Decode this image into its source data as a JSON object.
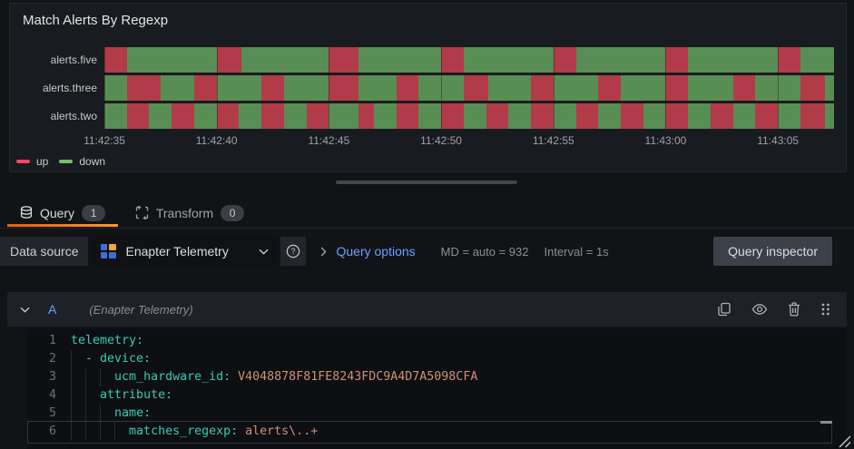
{
  "colors": {
    "accent_orange_start": "#e55e11",
    "accent_orange_end": "#ff9830",
    "link_blue": "#6e9fff",
    "legend_up": "#f2495c",
    "legend_down": "#73bf69",
    "fill_up": "#b23b4a",
    "fill_down": "#588e53"
  },
  "panel": {
    "title": "Match Alerts By Regexp"
  },
  "chart_data": {
    "type": "state-timeline",
    "title": "Match Alerts By Regexp",
    "x_range_seconds": [
      0,
      32.5
    ],
    "tick_interval_s": 5,
    "x_ticks": [
      "11:42:35",
      "11:42:40",
      "11:42:45",
      "11:42:50",
      "11:42:55",
      "11:43:00",
      "11:43:05"
    ],
    "legend": [
      {
        "label": "up",
        "state": "up"
      },
      {
        "label": "down",
        "state": "down"
      }
    ],
    "rows": [
      {
        "label": "alerts.five",
        "segments": [
          [
            "up",
            0,
            1
          ],
          [
            "down",
            1,
            5
          ],
          [
            "up",
            5,
            6.1
          ],
          [
            "down",
            6.1,
            10
          ],
          [
            "up",
            10,
            11.3
          ],
          [
            "down",
            11.3,
            15
          ],
          [
            "up",
            15,
            16
          ],
          [
            "down",
            16,
            20
          ],
          [
            "up",
            20,
            21
          ],
          [
            "down",
            21,
            25
          ],
          [
            "up",
            25,
            26
          ],
          [
            "down",
            26,
            30
          ],
          [
            "up",
            30,
            31
          ],
          [
            "down",
            31,
            32.5
          ]
        ]
      },
      {
        "label": "alerts.three",
        "segments": [
          [
            "down",
            0,
            1
          ],
          [
            "up",
            1,
            2.5
          ],
          [
            "down",
            2.5,
            4
          ],
          [
            "up",
            4,
            5
          ],
          [
            "down",
            5,
            7
          ],
          [
            "up",
            7,
            8
          ],
          [
            "down",
            8,
            10
          ],
          [
            "up",
            10,
            11.3
          ],
          [
            "down",
            11.3,
            13
          ],
          [
            "up",
            13,
            14
          ],
          [
            "down",
            14,
            16
          ],
          [
            "up",
            16,
            17.1
          ],
          [
            "down",
            17.1,
            19
          ],
          [
            "up",
            19,
            20
          ],
          [
            "down",
            20,
            22
          ],
          [
            "up",
            22,
            23
          ],
          [
            "down",
            23,
            25
          ],
          [
            "up",
            25,
            26
          ],
          [
            "down",
            26,
            28
          ],
          [
            "up",
            28,
            29
          ],
          [
            "down",
            29,
            31
          ],
          [
            "up",
            31,
            32.1
          ],
          [
            "down",
            32.1,
            32.5
          ]
        ]
      },
      {
        "label": "alerts.two",
        "segments": [
          [
            "down",
            0,
            1
          ],
          [
            "up",
            1,
            2
          ],
          [
            "down",
            2,
            3
          ],
          [
            "up",
            3,
            4
          ],
          [
            "down",
            4,
            5
          ],
          [
            "up",
            5,
            6
          ],
          [
            "down",
            6,
            7
          ],
          [
            "up",
            7,
            8
          ],
          [
            "down",
            8,
            9
          ],
          [
            "up",
            9,
            10
          ],
          [
            "down",
            10,
            11.3
          ],
          [
            "up",
            11.3,
            12
          ],
          [
            "down",
            12,
            13
          ],
          [
            "up",
            13,
            14
          ],
          [
            "down",
            14,
            15
          ],
          [
            "up",
            15,
            16
          ],
          [
            "down",
            16,
            17
          ],
          [
            "up",
            17,
            18
          ],
          [
            "down",
            18,
            19
          ],
          [
            "up",
            19,
            20
          ],
          [
            "down",
            20,
            21
          ],
          [
            "up",
            21,
            22
          ],
          [
            "down",
            22,
            23
          ],
          [
            "up",
            23,
            24
          ],
          [
            "down",
            24,
            25
          ],
          [
            "up",
            25,
            26
          ],
          [
            "down",
            26,
            27
          ],
          [
            "up",
            27,
            28
          ],
          [
            "down",
            28,
            29
          ],
          [
            "up",
            29,
            30
          ],
          [
            "down",
            30,
            31
          ],
          [
            "up",
            31,
            32.1
          ],
          [
            "down",
            32.1,
            32.5
          ]
        ]
      }
    ]
  },
  "tabs": {
    "query": {
      "label": "Query",
      "badge": "1"
    },
    "transform": {
      "label": "Transform",
      "badge": "0"
    }
  },
  "toolbar": {
    "datasource_label": "Data source",
    "datasource_value": "Enapter Telemetry",
    "query_options_label": "Query options",
    "stat_md": "MD = auto = 932",
    "stat_interval": "Interval = 1s",
    "query_inspector_label": "Query inspector"
  },
  "query_row": {
    "ref_id": "A",
    "datasource_hint": "(Enapter Telemetry)"
  },
  "editor": {
    "lines": [
      {
        "num": "1",
        "guides": 0,
        "tokens": [
          [
            "key",
            "telemetry:"
          ]
        ]
      },
      {
        "num": "2",
        "guides": 1,
        "tokens": [
          [
            "plain",
            "  "
          ],
          [
            "key",
            "- device:"
          ]
        ]
      },
      {
        "num": "3",
        "guides": 3,
        "tokens": [
          [
            "plain",
            "      "
          ],
          [
            "key",
            "ucm_hardware_id:"
          ],
          [
            "value",
            " V4048878F81FE8243FDC9A4D7A5098CFA"
          ]
        ]
      },
      {
        "num": "4",
        "guides": 2,
        "tokens": [
          [
            "plain",
            "    "
          ],
          [
            "key",
            "attribute:"
          ]
        ]
      },
      {
        "num": "5",
        "guides": 3,
        "tokens": [
          [
            "plain",
            "      "
          ],
          [
            "key",
            "name:"
          ]
        ]
      },
      {
        "num": "6",
        "guides": 4,
        "current": true,
        "tokens": [
          [
            "plain",
            "        "
          ],
          [
            "key",
            "matches_regexp:"
          ],
          [
            "value",
            " alerts\\..+"
          ]
        ]
      }
    ]
  }
}
